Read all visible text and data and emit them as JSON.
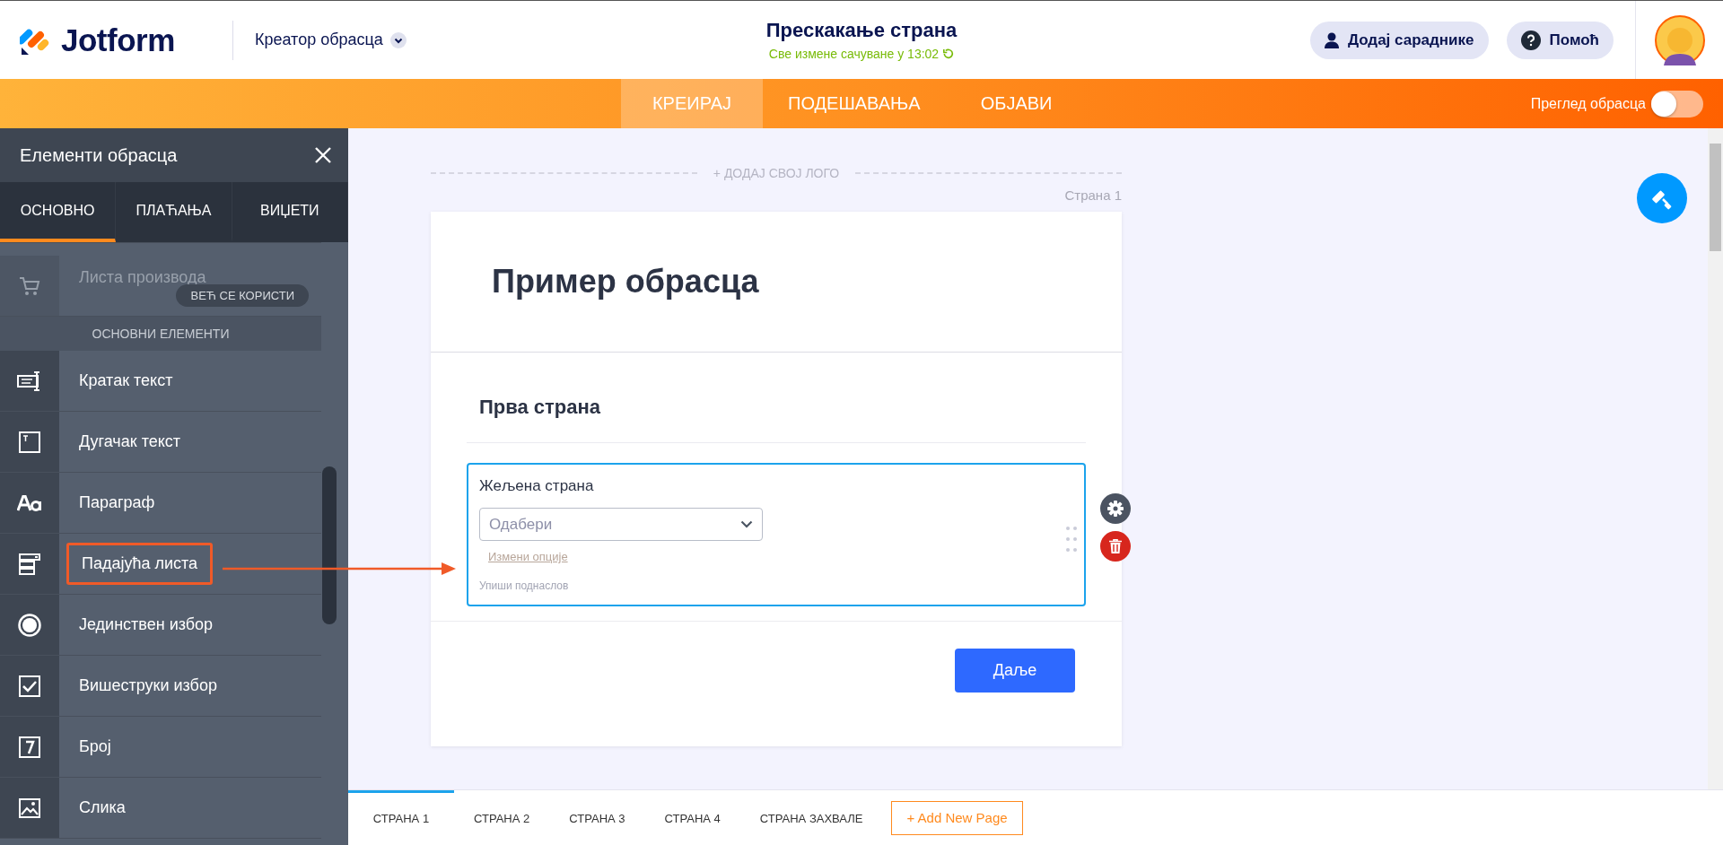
{
  "header": {
    "brand": "Jotform",
    "builder_menu": "Креатор обрасца",
    "title": "Прескакање страна",
    "save_status": "Све измене сачуване у 13:02",
    "buttons": [
      {
        "kind": "user",
        "label": "Додај сараднике"
      },
      {
        "kind": "help",
        "label": "Помоћ"
      }
    ]
  },
  "nav": {
    "tabs": [
      {
        "label": "КРЕИРАЈ",
        "selected": true
      },
      {
        "label": "ПОДЕШАВАЊА",
        "selected": false
      },
      {
        "label": "ОБЈАВИ",
        "selected": false
      }
    ],
    "preview": {
      "label": "Преглед обрасца",
      "on": false
    }
  },
  "sidebar": {
    "title": "Елементи обрасца",
    "tabs": [
      {
        "label": "ОСНОВНО",
        "selected": true
      },
      {
        "label": "ПЛАЋАЊА",
        "selected": false
      },
      {
        "label": "ВИЏЕТИ",
        "selected": false
      }
    ],
    "items": [
      {
        "kind": "product",
        "label": "Листа производа",
        "disabled": true,
        "badge": "ВЕЋ СЕ КОРИСТИ",
        "highlighted": false
      },
      {
        "kind": "section",
        "label": "ОСНОВНИ ЕЛЕМЕНТИ"
      },
      {
        "kind": "textbox",
        "label": "Кратак текст",
        "disabled": false,
        "highlighted": false
      },
      {
        "kind": "textarea",
        "label": "Дугачак текст",
        "disabled": false,
        "highlighted": false
      },
      {
        "kind": "paragraph",
        "label": "Параграф",
        "disabled": false,
        "highlighted": false
      },
      {
        "kind": "dropdown",
        "label": "Падајућа листа",
        "disabled": false,
        "highlighted": true
      },
      {
        "kind": "radio",
        "label": "Јединствен избор",
        "disabled": false,
        "highlighted": false
      },
      {
        "kind": "checkbox",
        "label": "Вишеструки избор",
        "disabled": false,
        "highlighted": false
      },
      {
        "kind": "number",
        "label": "Број",
        "disabled": false,
        "highlighted": false
      },
      {
        "kind": "image",
        "label": "Слика",
        "disabled": false,
        "highlighted": false
      }
    ]
  },
  "canvas": {
    "add_logo": "+ ДОДАЈ СВОЈ ЛОГО",
    "page_label": "Страна 1",
    "form_title": "Пример обрасца",
    "section_title": "Прва страна",
    "field": {
      "label": "Жељена страна",
      "placeholder": "Одабери",
      "edit_options": "Измени опције",
      "subheading": "Упиши поднаслов",
      "selected": true
    },
    "next_button": "Даље"
  },
  "page_tabs": {
    "tabs": [
      {
        "label": "СТРАНА 1",
        "selected": true
      },
      {
        "label": "СТРАНА 2",
        "selected": false
      },
      {
        "label": "СТРАНА 3",
        "selected": false
      },
      {
        "label": "СТРАНА 4",
        "selected": false
      },
      {
        "label": "СТРАНА ЗАХВАЛЕ",
        "selected": false
      }
    ],
    "add_button": "+ Add New Page"
  }
}
